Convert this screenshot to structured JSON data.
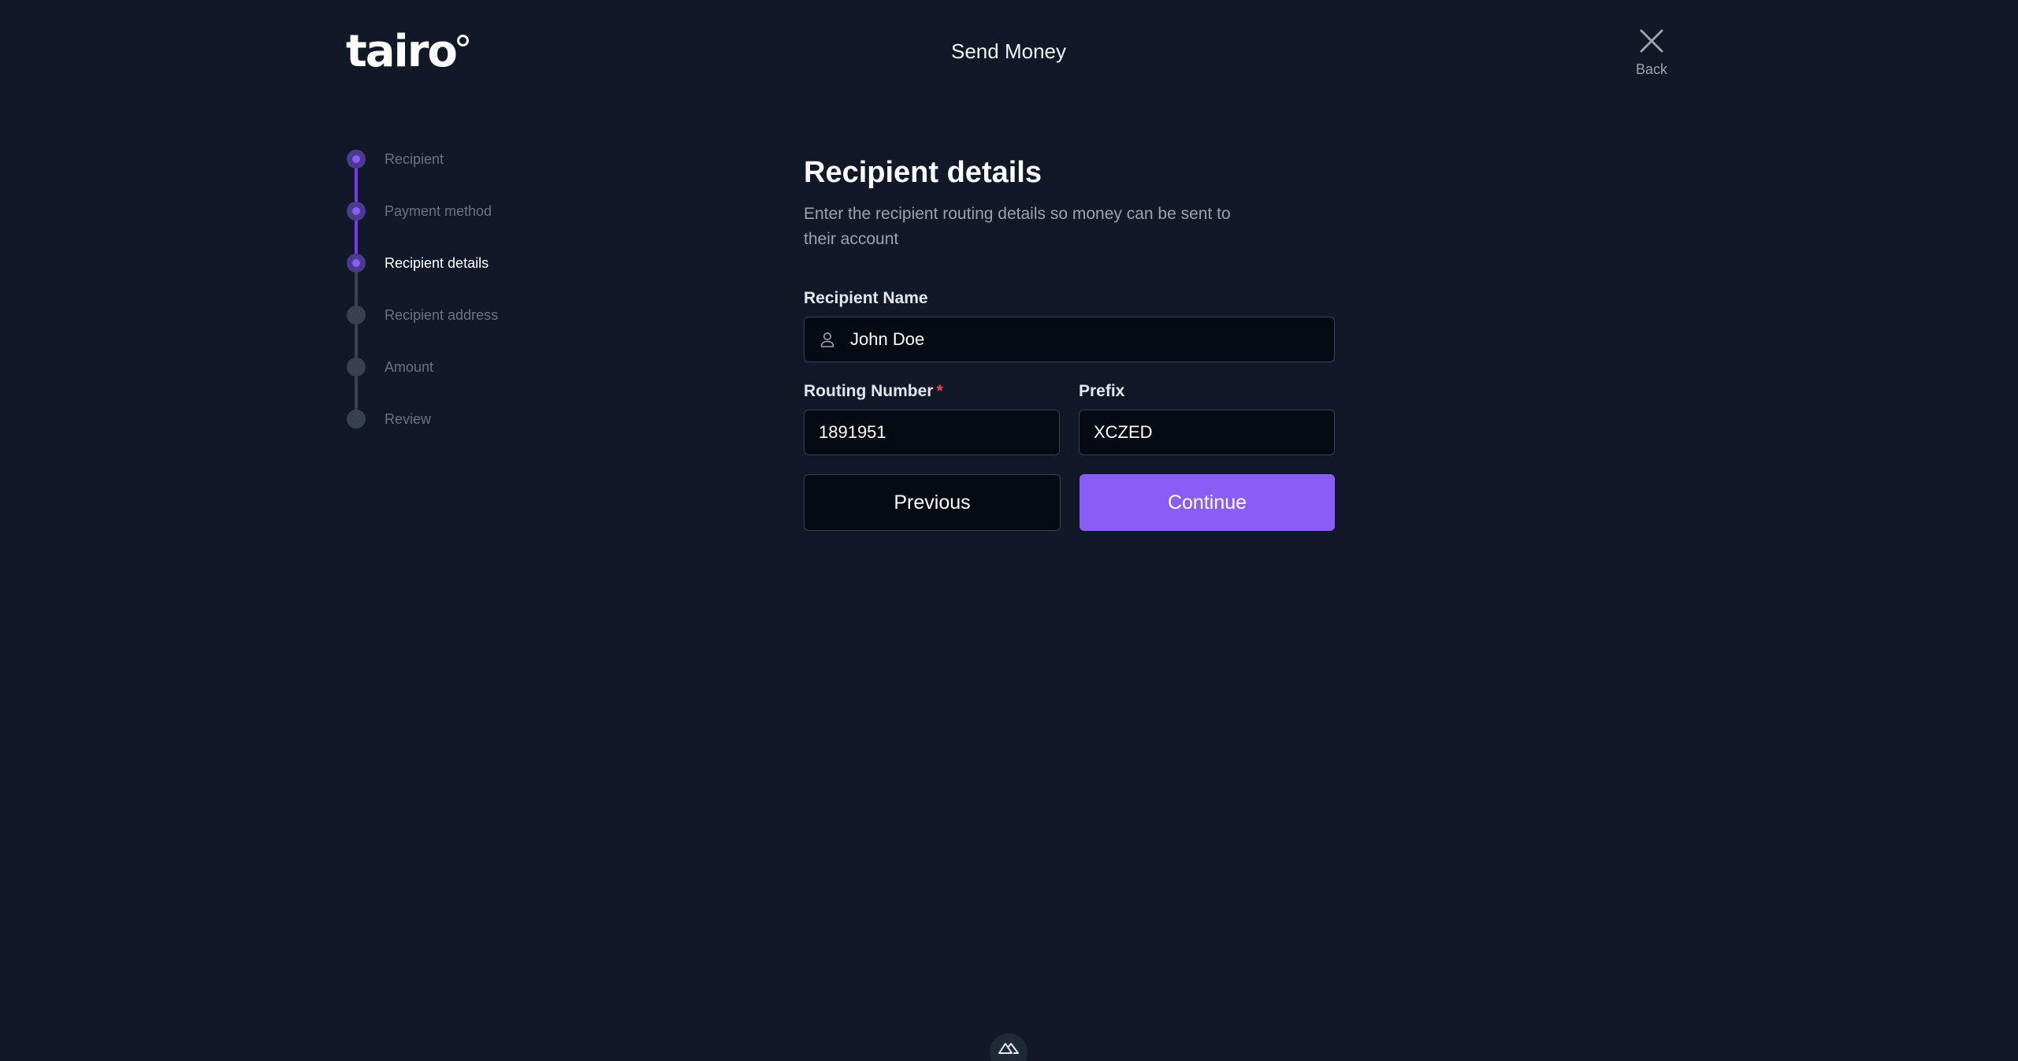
{
  "header": {
    "logo_text": "tairo",
    "title": "Send Money",
    "back_label": "Back"
  },
  "stepper": {
    "steps": [
      {
        "label": "Recipient",
        "state": "done"
      },
      {
        "label": "Payment method",
        "state": "done"
      },
      {
        "label": "Recipient details",
        "state": "current"
      },
      {
        "label": "Recipient address",
        "state": "pending"
      },
      {
        "label": "Amount",
        "state": "pending"
      },
      {
        "label": "Review",
        "state": "pending"
      }
    ]
  },
  "form": {
    "title": "Recipient details",
    "subtitle": "Enter the recipient routing details so money can be sent to their account",
    "recipient_name": {
      "label": "Recipient Name",
      "value": "John Doe",
      "icon": "user-icon"
    },
    "routing_number": {
      "label": "Routing Number",
      "required_mark": "*",
      "value": "1891951"
    },
    "prefix": {
      "label": "Prefix",
      "value": "XCZED"
    },
    "previous_label": "Previous",
    "continue_label": "Continue"
  },
  "colors": {
    "background": "#111827",
    "accent": "#8b5cf6",
    "required": "#f43f5e"
  }
}
